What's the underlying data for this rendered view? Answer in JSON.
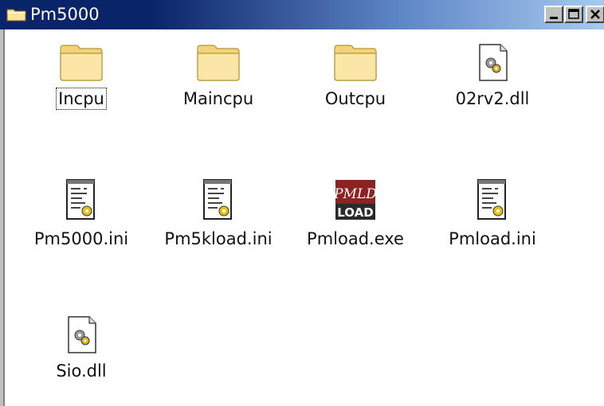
{
  "window": {
    "title": "Pm5000",
    "title_icon": "folder-icon",
    "controls": {
      "minimize": "minimize-icon",
      "maximize": "maximize-icon",
      "close": "close-icon"
    }
  },
  "items": [
    {
      "name": "Incpu",
      "icon": "folder-icon",
      "focused": true
    },
    {
      "name": "Maincpu",
      "icon": "folder-icon"
    },
    {
      "name": "Outcpu",
      "icon": "folder-icon"
    },
    {
      "name": "02rv2.dll",
      "icon": "dll-gear-file-icon"
    },
    {
      "name": "Pm5000.ini",
      "icon": "ini-settings-file-icon"
    },
    {
      "name": "Pm5kload.ini",
      "icon": "ini-settings-file-icon"
    },
    {
      "name": "Pmload.exe",
      "icon": "pmld-load-app-icon",
      "icon_text": {
        "top": "PMLD",
        "bottom": "LOAD"
      }
    },
    {
      "name": "Pmload.ini",
      "icon": "ini-settings-file-icon"
    },
    {
      "name": "Sio.dll",
      "icon": "dll-gear-file-icon"
    }
  ],
  "colors": {
    "titlebar_start": "#0a246a",
    "titlebar_end": "#a6caf0",
    "folder": "#fbe49a",
    "background": "#ffffff"
  }
}
